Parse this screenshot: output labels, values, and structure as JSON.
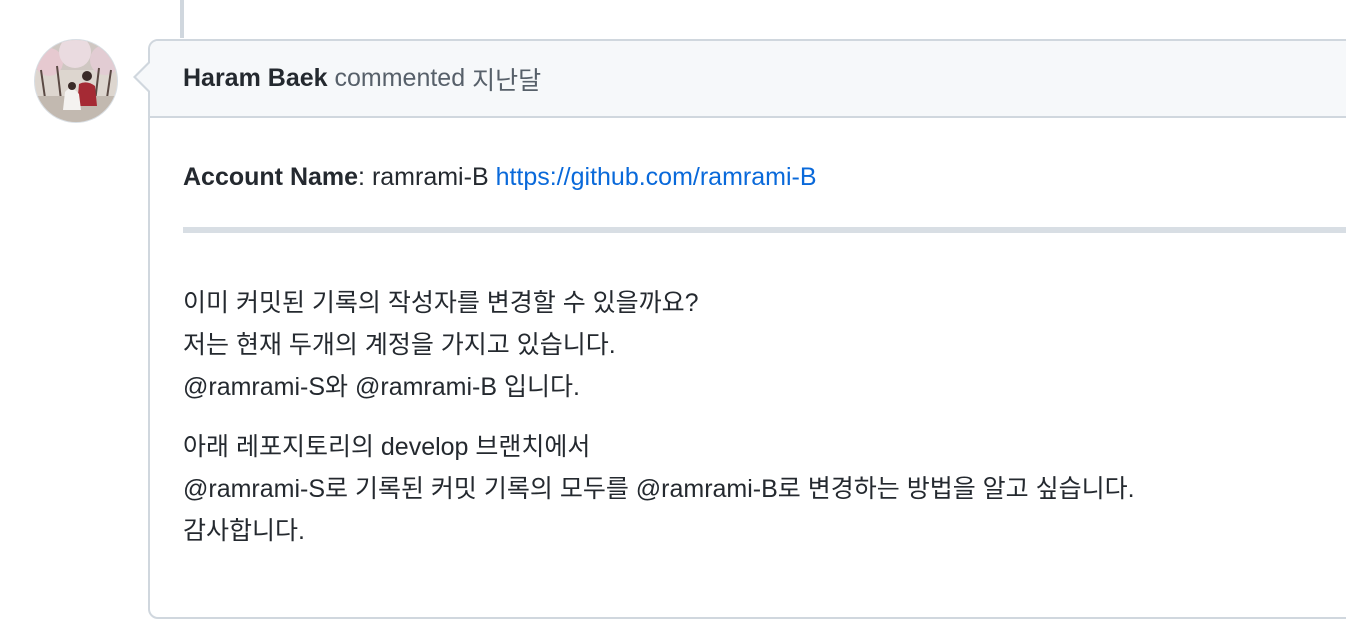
{
  "avatar": {
    "icon": "user-avatar-photo"
  },
  "comment": {
    "author": "Haram Baek",
    "action": "commented",
    "timestamp": "지난달",
    "account_label": "Account Name",
    "account_colon": ":",
    "account_value": "ramrami-B",
    "account_link": "https://github.com/ramrami-B",
    "paragraphs": [
      [
        "이미 커밋된 기록의 작성자를 변경할 수 있을까요?",
        "저는 현재 두개의 계정을 가지고 있습니다.",
        "@ramrami-S와 @ramrami-B 입니다."
      ],
      [
        "아래 레포지토리의 develop 브랜치에서",
        "@ramrami-S로 기록된 커밋 기록의 모두를 @ramrami-B로 변경하는 방법을 알고 싶습니다.",
        "감사합니다."
      ]
    ]
  },
  "colors": {
    "border": "#d0d7de",
    "header_bg": "#f6f8fa",
    "link": "#0969da",
    "muted_text": "#57606a"
  }
}
